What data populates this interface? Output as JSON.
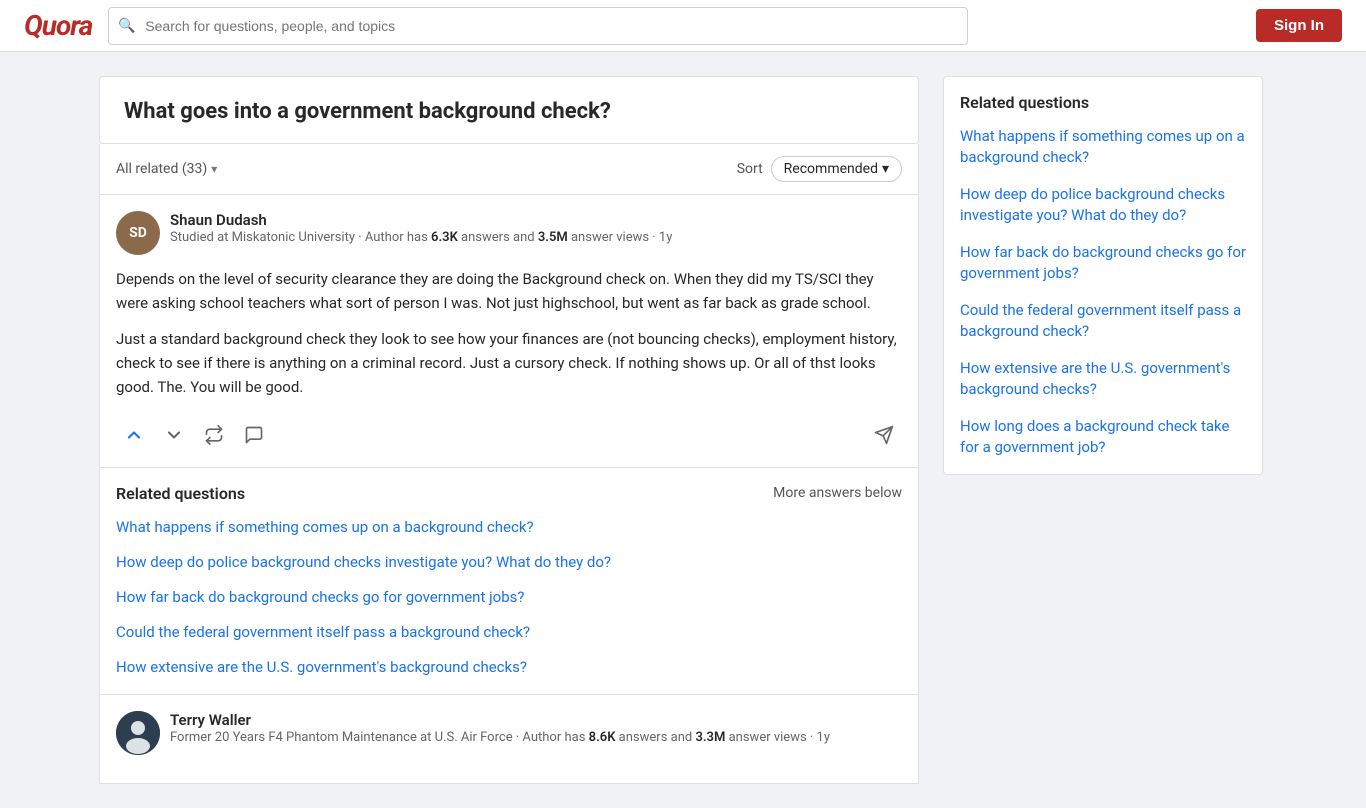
{
  "header": {
    "logo": "Quora",
    "search_placeholder": "Search for questions, people, and topics",
    "sign_in": "Sign In"
  },
  "question": {
    "title": "What goes into a government background check?",
    "all_related_label": "All related (33)",
    "sort_label": "Sort",
    "sort_value": "Recommended"
  },
  "answer1": {
    "author_name": "Shaun Dudash",
    "author_meta": "Studied at Miskatonic University · Author has ",
    "answers_count": "6.3K",
    "answers_label": " answers and ",
    "views_count": "3.5M",
    "views_label": " answer views · 1y",
    "para1": "Depends on the level of security clearance they are doing the Background check on. When they did my TS/SCI they were asking school teachers what sort of person I was. Not just highschool, but went as far back as grade school.",
    "para2": "Just a standard background check they look to see how your finances are (not bouncing checks), employment history, check to see if there is anything on a criminal record. Just a cursory check. If nothing shows up. Or all of thst looks good. The. You will be good."
  },
  "related_inline": {
    "title": "Related questions",
    "more_answers": "More answers below",
    "links": [
      "What happens if something comes up on a background check?",
      "How deep do police background checks investigate you? What do they do?",
      "How far back do background checks go for government jobs?",
      "Could the federal government itself pass a background check?",
      "How extensive are the U.S. government's background checks?"
    ]
  },
  "answer2": {
    "author_name": "Terry Waller",
    "author_meta": "Former 20 Years F4 Phantom Maintenance at U.S. Air Force · Author has ",
    "answers_count": "8.6K",
    "answers_label": " answers and ",
    "views_count": "3.3M",
    "views_label": " answer views · 1y"
  },
  "sidebar": {
    "title": "Related questions",
    "links": [
      "What happens if something comes up on a background check?",
      "How deep do police background checks investigate you? What do they do?",
      "How far back do background checks go for government jobs?",
      "Could the federal government itself pass a background check?",
      "How extensive are the U.S. government's background checks?",
      "How long does a background check take for a government job?"
    ]
  },
  "icons": {
    "search": "🔍",
    "chevron_down": "▾",
    "upvote": "↑",
    "downvote": "↓",
    "share_rotate": "↻",
    "comment": "○",
    "share": "↗"
  }
}
